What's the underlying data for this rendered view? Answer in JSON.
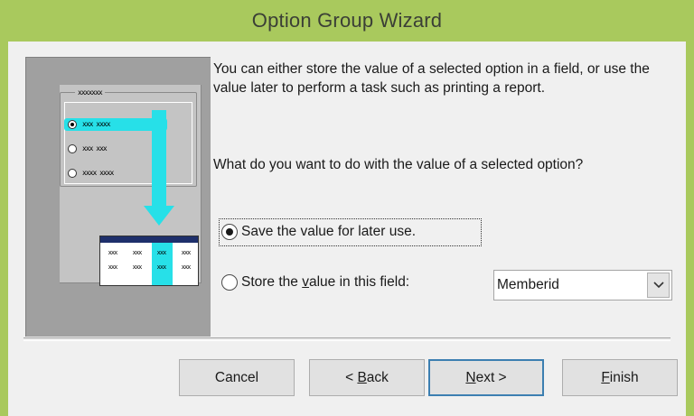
{
  "window": {
    "title": "Option Group Wizard"
  },
  "illustration": {
    "legend": "xxxxxxx",
    "options": [
      "xxx xxxx",
      "xxx xxx",
      "xxxx xxxx"
    ],
    "table_rows": [
      [
        "xxx",
        "xxx",
        "xxx",
        "xxx"
      ],
      [
        "xxx",
        "xxx",
        "xxx",
        "xxx"
      ]
    ]
  },
  "description": "You can either store the value of a selected option in a field, or use the value later to perform a task such as printing a report.",
  "question": "What do you want to do with the value of a selected option?",
  "choices": {
    "save": {
      "label": "Save the value for later use.",
      "selected": true
    },
    "store": {
      "label_before": "Store the ",
      "label_accel": "v",
      "label_after": "alue in this field:",
      "selected": false
    }
  },
  "field_select": {
    "value": "Memberid"
  },
  "buttons": {
    "cancel": "Cancel",
    "back_prefix": "< ",
    "back_accel": "B",
    "back_rest": "ack",
    "next_accel": "N",
    "next_rest": "ext >",
    "finish_accel": "F",
    "finish_rest": "inish"
  },
  "colors": {
    "title_bar": "#a9c95d",
    "highlight": "#27e0e8",
    "default_button_border": "#3c7fb1"
  }
}
